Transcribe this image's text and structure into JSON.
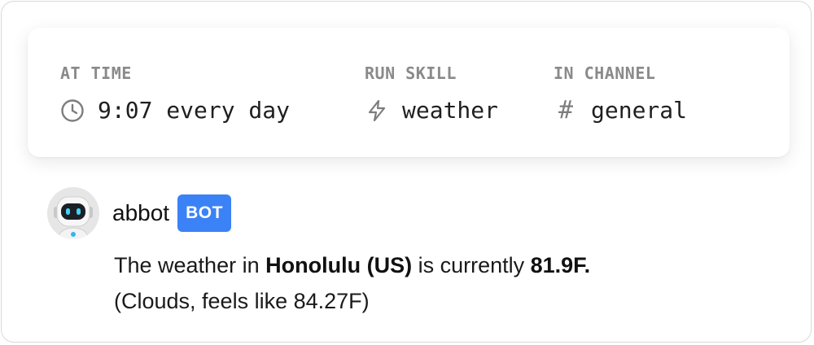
{
  "schedule": {
    "time": {
      "label": "AT TIME",
      "value": "9:07 every day",
      "icon": "clock-icon"
    },
    "skill": {
      "label": "RUN SKILL",
      "value": "weather",
      "icon": "lightning-icon"
    },
    "channel": {
      "label": "IN CHANNEL",
      "value": "general",
      "icon": "hash-icon",
      "symbol": "#"
    }
  },
  "message": {
    "author": "abbot",
    "badge": "BOT",
    "text": {
      "part1": "The weather in ",
      "location": "Honolulu (US)",
      "part2": " is currently ",
      "temperature": "81.9F.",
      "part3": "(Clouds, feels like 84.27F)"
    }
  },
  "colors": {
    "badge_bg": "#3b82f6",
    "label_gray": "#8a8a8a",
    "text_dark": "#1f1f1f"
  }
}
